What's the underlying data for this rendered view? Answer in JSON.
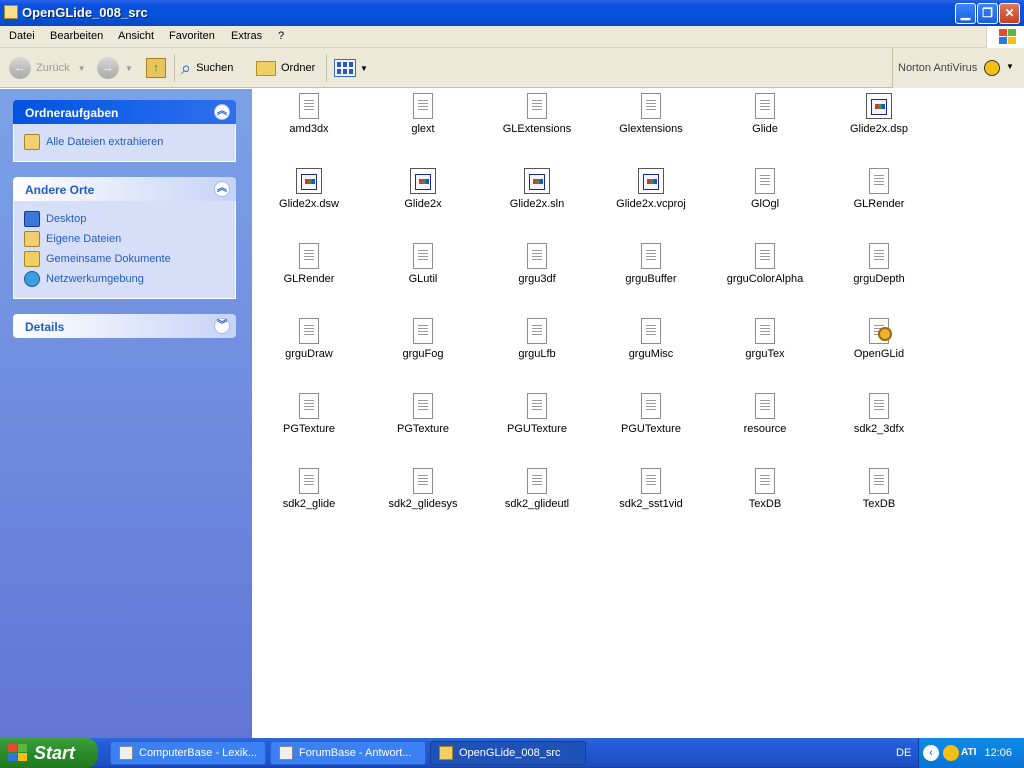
{
  "window": {
    "title": "OpenGLide_008_src",
    "controls": [
      "minimize",
      "maximize",
      "close"
    ]
  },
  "menu": [
    "Datei",
    "Bearbeiten",
    "Ansicht",
    "Favoriten",
    "Extras",
    "?"
  ],
  "toolbar": {
    "back_label": "Zurück",
    "search_label": "Suchen",
    "folders_label": "Ordner",
    "norton_label": "Norton AntiVirus"
  },
  "sidebar": {
    "tasks": {
      "title": "Ordneraufgaben",
      "links": [
        "Alle Dateien extrahieren"
      ]
    },
    "places": {
      "title": "Andere Orte",
      "links": [
        "Desktop",
        "Eigene Dateien",
        "Gemeinsame Dokumente",
        "Netzwerkumgebung"
      ]
    },
    "details": {
      "title": "Details"
    }
  },
  "files": [
    {
      "name": "amd3dx",
      "icon": "text-doc-icon"
    },
    {
      "name": "glext",
      "icon": "text-doc-icon"
    },
    {
      "name": "GLExtensions",
      "icon": "text-doc-icon"
    },
    {
      "name": "Glextensions",
      "icon": "text-doc-icon"
    },
    {
      "name": "Glide",
      "icon": "text-doc-icon"
    },
    {
      "name": "Glide2x.dsp",
      "icon": "vs-project-icon"
    },
    {
      "name": "Glide2x.dsw",
      "icon": "vs-project-icon"
    },
    {
      "name": "Glide2x",
      "icon": "vs-project-icon"
    },
    {
      "name": "Glide2x.sln",
      "icon": "vs-project-icon"
    },
    {
      "name": "Glide2x.vcproj",
      "icon": "vs-project-icon"
    },
    {
      "name": "GlOgl",
      "icon": "text-doc-icon"
    },
    {
      "name": "GLRender",
      "icon": "text-doc-icon"
    },
    {
      "name": "GLRender",
      "icon": "text-doc-icon"
    },
    {
      "name": "GLutil",
      "icon": "text-doc-icon"
    },
    {
      "name": "grgu3df",
      "icon": "text-doc-icon"
    },
    {
      "name": "grguBuffer",
      "icon": "text-doc-icon"
    },
    {
      "name": "grguColorAlpha",
      "icon": "text-doc-icon"
    },
    {
      "name": "grguDepth",
      "icon": "text-doc-icon"
    },
    {
      "name": "grguDraw",
      "icon": "text-doc-icon"
    },
    {
      "name": "grguFog",
      "icon": "text-doc-icon"
    },
    {
      "name": "grguLfb",
      "icon": "text-doc-icon"
    },
    {
      "name": "grguMisc",
      "icon": "text-doc-icon"
    },
    {
      "name": "grguTex",
      "icon": "text-doc-icon"
    },
    {
      "name": "OpenGLid",
      "icon": "setup-info-icon"
    },
    {
      "name": "PGTexture",
      "icon": "text-doc-icon"
    },
    {
      "name": "PGTexture",
      "icon": "text-doc-icon"
    },
    {
      "name": "PGUTexture",
      "icon": "text-doc-icon"
    },
    {
      "name": "PGUTexture",
      "icon": "text-doc-icon"
    },
    {
      "name": "resource",
      "icon": "text-doc-icon"
    },
    {
      "name": "sdk2_3dfx",
      "icon": "text-doc-icon"
    },
    {
      "name": "sdk2_glide",
      "icon": "text-doc-icon"
    },
    {
      "name": "sdk2_glidesys",
      "icon": "text-doc-icon"
    },
    {
      "name": "sdk2_glideutl",
      "icon": "text-doc-icon"
    },
    {
      "name": "sdk2_sst1vid",
      "icon": "text-doc-icon"
    },
    {
      "name": "TexDB",
      "icon": "text-doc-icon"
    },
    {
      "name": "TexDB",
      "icon": "text-doc-icon"
    }
  ],
  "taskbar": {
    "start_label": "Start",
    "tasks": [
      {
        "label": "ComputerBase - Lexik..."
      },
      {
        "label": "ForumBase - Antwort..."
      },
      {
        "label": "OpenGLide_008_src"
      }
    ],
    "language": "DE",
    "tray_ati": "ATI",
    "clock": "12:06"
  }
}
